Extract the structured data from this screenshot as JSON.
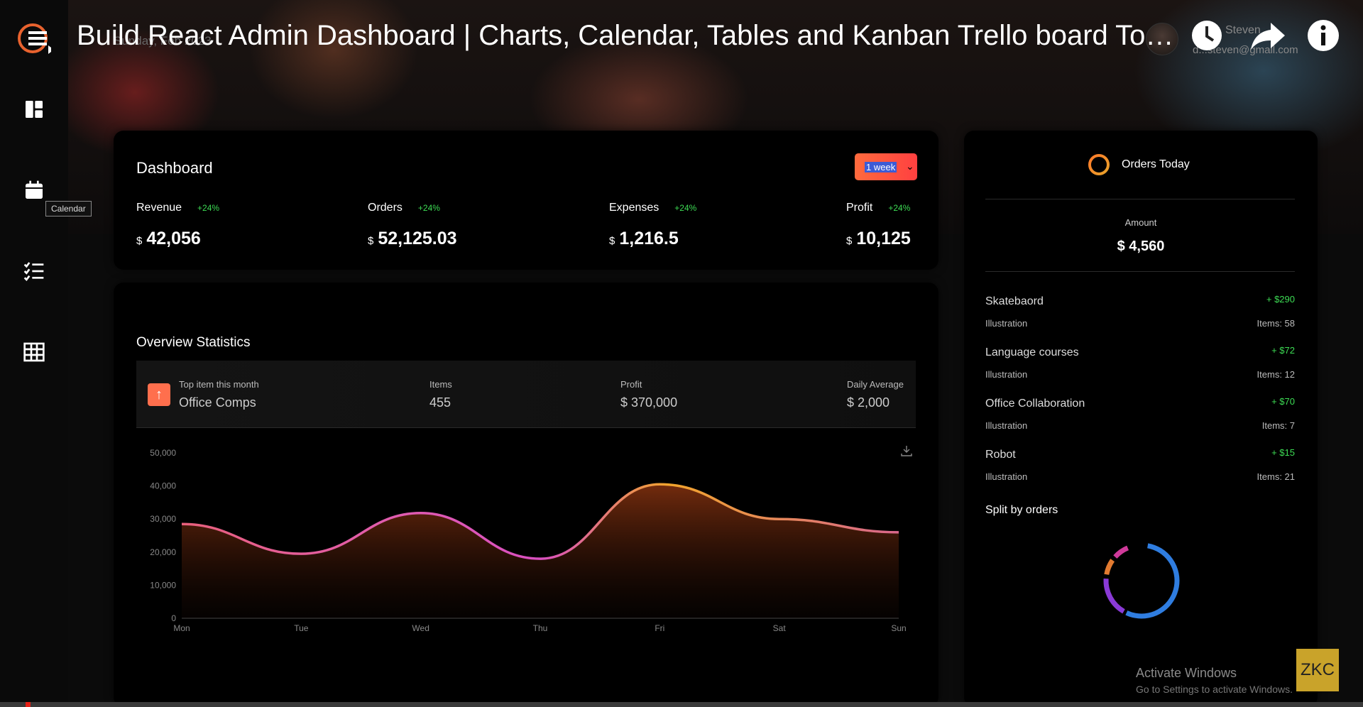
{
  "video": {
    "title": "Build React Admin Dashboard | Charts, Calendar, Tables and Kanban Trello board Tod...",
    "underlay_date": "Sunday, Feb 2023",
    "progress_fraction": 0.0037
  },
  "sidebar": {
    "tooltip": "Calendar",
    "items": [
      {
        "icon": "dashboard-icon"
      },
      {
        "icon": "calendar-icon"
      },
      {
        "icon": "checklist-icon"
      },
      {
        "icon": "table-icon"
      }
    ]
  },
  "user": {
    "name": "Steven",
    "email": "d...steven@gmail.com"
  },
  "dashboard": {
    "title": "Dashboard",
    "period": "1 week",
    "metrics": [
      {
        "label": "Revenue",
        "change": "+24%",
        "currency": "$",
        "value": "42,056"
      },
      {
        "label": "Orders",
        "change": "+24%",
        "currency": "$",
        "value": "52,125.03"
      },
      {
        "label": "Expenses",
        "change": "+24%",
        "currency": "$",
        "value": "1,216.5"
      },
      {
        "label": "Profit",
        "change": "+24%",
        "currency": "$",
        "value": "10,125"
      }
    ]
  },
  "overview": {
    "title": "Overview Statistics",
    "top_item": {
      "label": "Top item this month",
      "value": "Office Comps"
    },
    "items": {
      "label": "Items",
      "value": "455"
    },
    "profit": {
      "label": "Profit",
      "value": "$ 370,000"
    },
    "daily_average": {
      "label": "Daily Average",
      "value": "$ 2,000"
    }
  },
  "chart_data": {
    "type": "area",
    "categories": [
      "Mon",
      "Tue",
      "Wed",
      "Thu",
      "Fri",
      "Sat",
      "Sun"
    ],
    "values": [
      28500,
      19500,
      31800,
      18000,
      40500,
      30000,
      26000
    ],
    "ylim": [
      0,
      50000
    ],
    "yticks": [
      "0",
      "10,000",
      "20,000",
      "30,000",
      "40,000",
      "50,000"
    ],
    "grid": false
  },
  "orders_today": {
    "title": "Orders Today",
    "amount_label": "Amount",
    "amount": "$ 4,560",
    "list": [
      {
        "name": "Skatebaord",
        "gain": "+ $290",
        "type": "Illustration",
        "items": "Items: 58"
      },
      {
        "name": "Language courses",
        "gain": "+ $72",
        "type": "Illustration",
        "items": "Items: 12"
      },
      {
        "name": "Office Collaboration",
        "gain": "+ $70",
        "type": "Illustration",
        "items": "Items: 7"
      },
      {
        "name": "Robot",
        "gain": "+ $15",
        "type": "Illustration",
        "items": "Items: 21"
      }
    ],
    "split_title": "Split by orders"
  },
  "windows": {
    "activate_title": "Activate Windows",
    "activate_sub": "Go to Settings to activate Windows."
  },
  "watermark": "ZKC",
  "colors": {
    "accent_orange": "#ff6a3d",
    "positive_green": "#3ddc54",
    "line_pink": "#e85fa5",
    "line_orange": "#f0a030"
  }
}
